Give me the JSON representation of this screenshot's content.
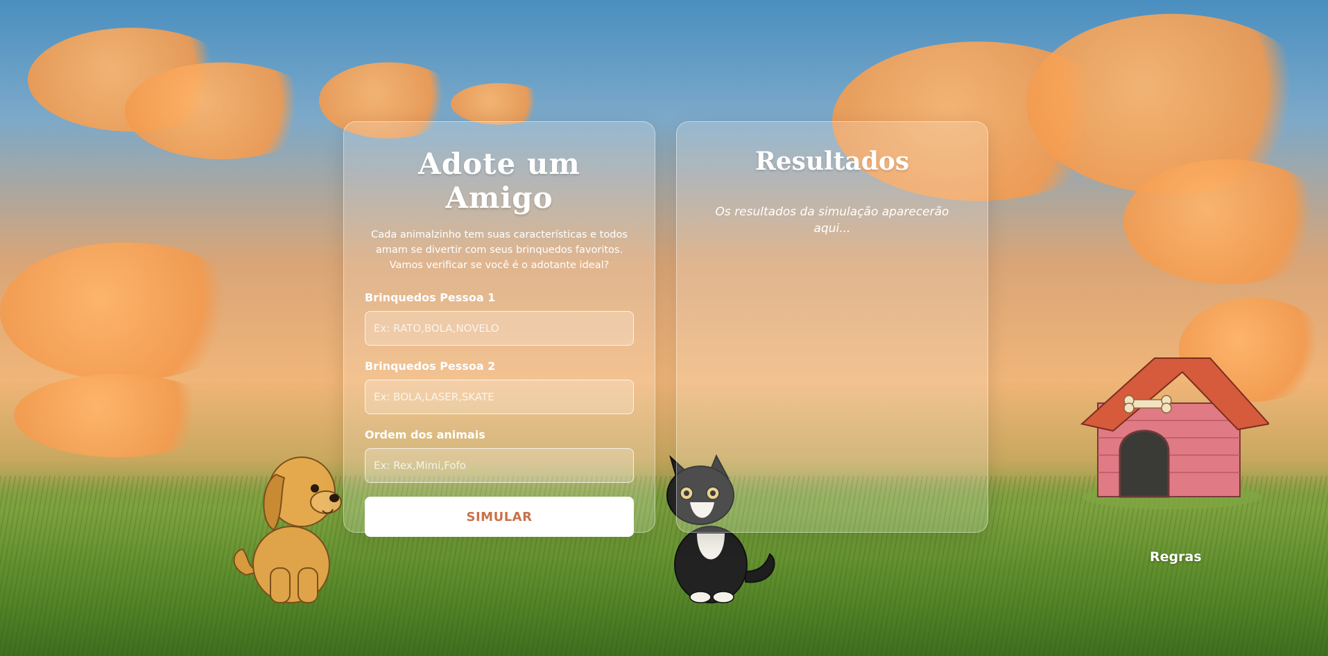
{
  "form": {
    "title": "Adote um Amigo",
    "subtitle": "Cada animalzinho tem suas características e todos amam se divertir com seus brinquedos favoritos. Vamos verificar se você é o adotante ideal?",
    "fields": [
      {
        "label": "Brinquedos Pessoa 1",
        "placeholder": "Ex: RATO,BOLA,NOVELO",
        "value": ""
      },
      {
        "label": "Brinquedos Pessoa 2",
        "placeholder": "Ex: BOLA,LASER,SKATE",
        "value": ""
      },
      {
        "label": "Ordem dos animais",
        "placeholder": "Ex: Rex,Mimi,Fofo",
        "value": ""
      }
    ],
    "submit_label": "SIMULAR"
  },
  "results": {
    "title": "Resultados",
    "empty_message": "Os resultados da simulação aparecerão aqui..."
  },
  "footer": {
    "rules_link": "Regras"
  },
  "scene": {
    "illustrations": [
      "dog-illustration",
      "cat-illustration",
      "doghouse-illustration"
    ]
  },
  "colors": {
    "accent": "#c9724a",
    "sky_top": "#4a8fc0",
    "sunset": "#f0b578",
    "grass": "#5e8d2c"
  }
}
